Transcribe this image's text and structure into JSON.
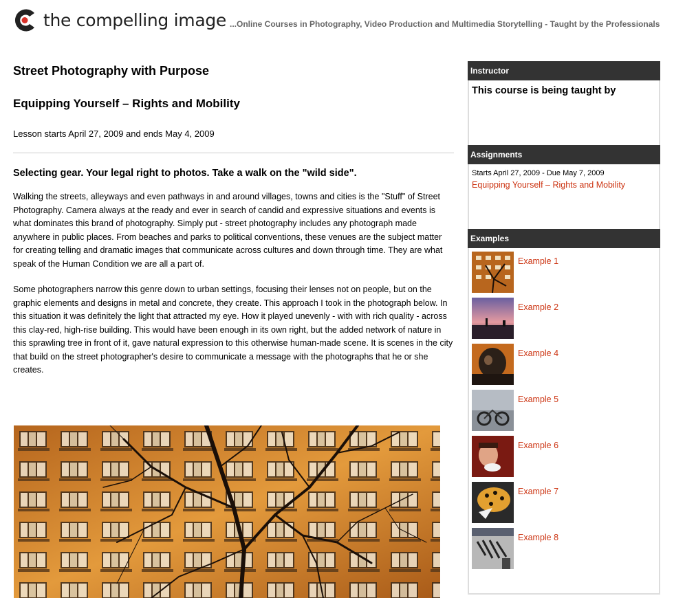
{
  "header": {
    "logo_text": "the compelling image",
    "tagline": "...Online Courses in Photography, Video Production and Multimedia Storytelling - Taught by the Professionals"
  },
  "main": {
    "course_title": "Street Photography with Purpose",
    "lesson_title": "Equipping Yourself – Rights and Mobility",
    "lesson_dates": "Lesson starts April 27, 2009 and ends May 4, 2009",
    "intro": "Selecting gear. Your legal right to photos. Take a walk on the \"wild side\".",
    "paragraphs": [
      "Walking the streets, alleyways and even pathways in and around villages, towns and cities is the \"Stuff\" of Street Photography. Camera always at the ready and ever in search of candid and expressive situations and events is what dominates this brand of photography. Simply put - street photography includes any photograph made anywhere in public places. From beaches and parks to political conventions, these venues are the subject matter for creating telling and dramatic images that communicate across cultures and down through time. They are what speak of the Human Condition we are all a part of.",
      "Some photographers narrow this genre down to urban settings, focusing their lenses not on people, but on the graphic elements and designs in metal and concrete, they create. This approach I took in the photograph below. In this situation it was definitely the light that attracted my eye. How it played unevenly - with with rich quality - across this clay-red, high-rise building. This would have been enough in its own right, but the added network of nature in this sprawling tree in front of it, gave natural expression to this otherwise human-made scene. It is scenes in the city that build on the street photographer's desire to communicate a message with the photographs that he or she creates."
    ]
  },
  "sidebar": {
    "instructor": {
      "heading": "Instructor",
      "text": "This course is being taught by"
    },
    "assignments": {
      "heading": "Assignments",
      "dates": "Starts April 27, 2009 - Due May 7, 2009",
      "link": "Equipping Yourself – Rights and Mobility"
    },
    "examples": {
      "heading": "Examples",
      "items": [
        "Example 1",
        "Example 2",
        "Example 4",
        "Example 5",
        "Example 6",
        "Example 7",
        "Example 8"
      ]
    }
  },
  "colors": {
    "link": "#cc3311",
    "panel_header": "#333333",
    "logo_accent": "#d9322a"
  }
}
